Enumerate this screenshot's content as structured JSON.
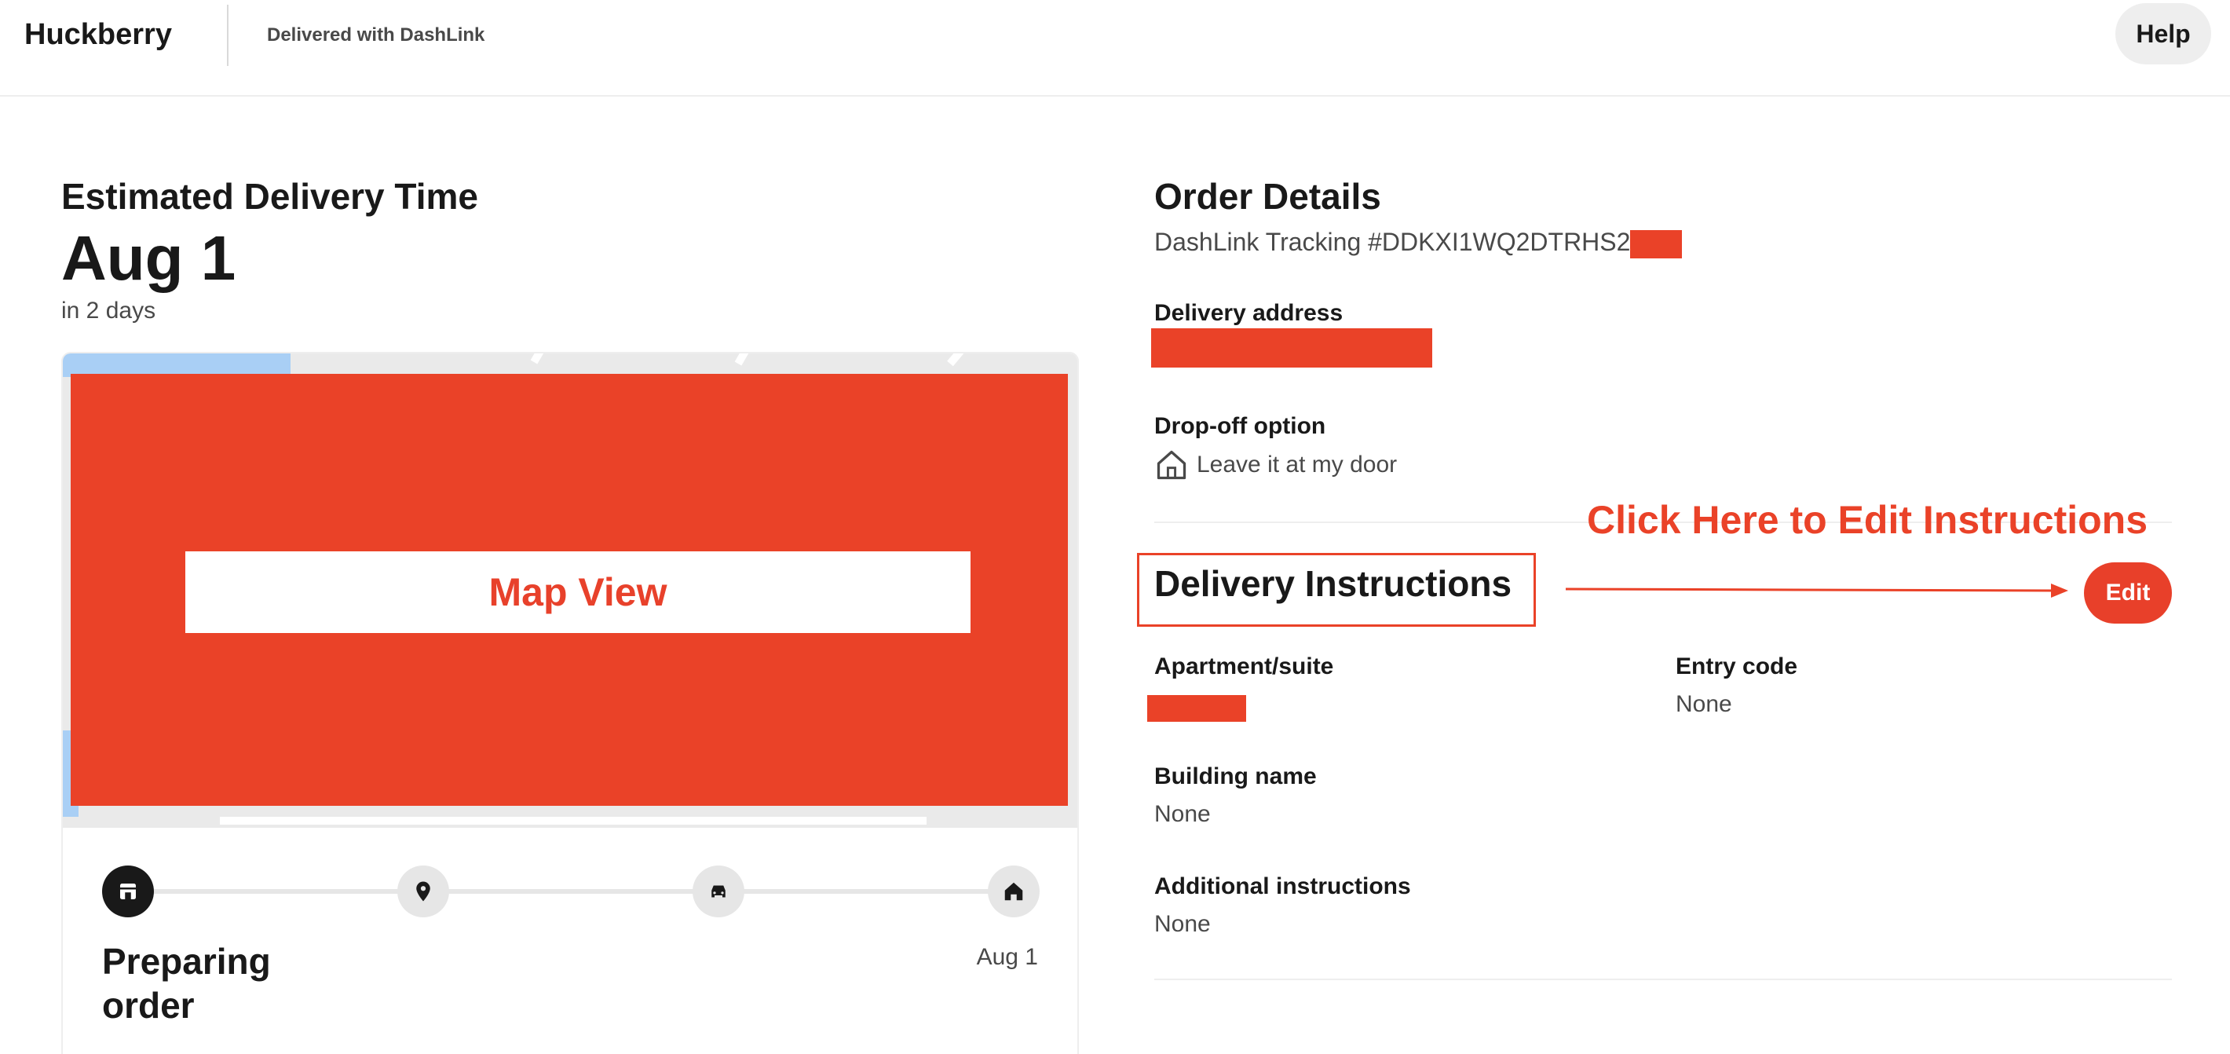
{
  "header": {
    "brand": "Huckberry",
    "delivered_with": "Delivered with DashLink",
    "help_label": "Help"
  },
  "estimate": {
    "title": "Estimated Delivery Time",
    "date": "Aug 1",
    "relative": "in 2 days"
  },
  "map": {
    "label": "Map View"
  },
  "status": {
    "title": "Preparing order",
    "date": "Aug 1",
    "steps": [
      "store-icon",
      "location-pin-icon",
      "car-icon",
      "home-icon"
    ]
  },
  "order": {
    "title": "Order Details",
    "tracking": "DashLink Tracking #DDKXI1WQ2DTRHS2",
    "delivery_address_label": "Delivery address",
    "dropoff_label": "Drop-off option",
    "dropoff_value": "Leave it at my door"
  },
  "instructions": {
    "title": "Delivery Instructions",
    "annotation": "Click Here to Edit Instructions",
    "edit_label": "Edit",
    "apartment_label": "Apartment/suite",
    "entry_code_label": "Entry code",
    "entry_code_value": "None",
    "building_label": "Building name",
    "building_value": "None",
    "additional_label": "Additional instructions",
    "additional_value": "None"
  },
  "colors": {
    "accent": "#ea4228",
    "text": "#191919",
    "muted": "#494949"
  }
}
